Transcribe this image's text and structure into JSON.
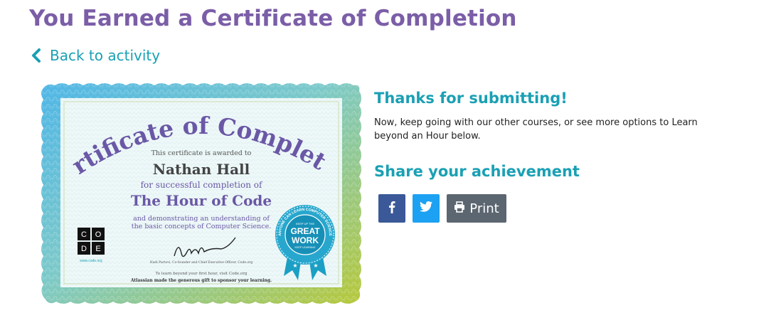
{
  "page": {
    "title": "You Earned a Certificate of Completion",
    "back_label": "Back to activity"
  },
  "certificate": {
    "heading": "Certificate of Completion",
    "awarded_line": "This certificate is awarded to",
    "recipient": "Nathan Hall",
    "completion_line": "for successful completion of",
    "course": "The Hour of Code",
    "description_1": "and demonstrating an understanding of",
    "description_2": "the basic concepts of Computer Science.",
    "signatory": "Hadi Partovi, Co-founder and Chief Executive Officer, Code.org",
    "learn_more": "To learn beyond your first hour, visit Code.org",
    "sponsor": "Atlassian made the generous gift to sponsor your learning.",
    "logo_letters": [
      "C",
      "O",
      "D",
      "E"
    ],
    "logo_url": "www.code.org",
    "badge_line_big_1": "GREAT",
    "badge_line_big_2": "WORK",
    "badge_top": "KEEP UP THE",
    "badge_bottom": "KEEP LEARNING",
    "badge_ring": "ANYONE CAN LEARN COMPUTER SCIENCE"
  },
  "info": {
    "thanks": "Thanks for submitting!",
    "message": "Now, keep going with our other courses, or see more options to Learn beyond an Hour below.",
    "share_heading": "Share your achievement",
    "print_label": "Print"
  },
  "colors": {
    "title": "#7b5ea7",
    "accent": "#1aa0b4",
    "facebook": "#3b5998",
    "twitter": "#1da1f2",
    "print": "#5c6670"
  },
  "icons": {
    "back": "chevron-left-icon",
    "facebook": "facebook-icon",
    "twitter": "twitter-icon",
    "print": "printer-icon"
  }
}
